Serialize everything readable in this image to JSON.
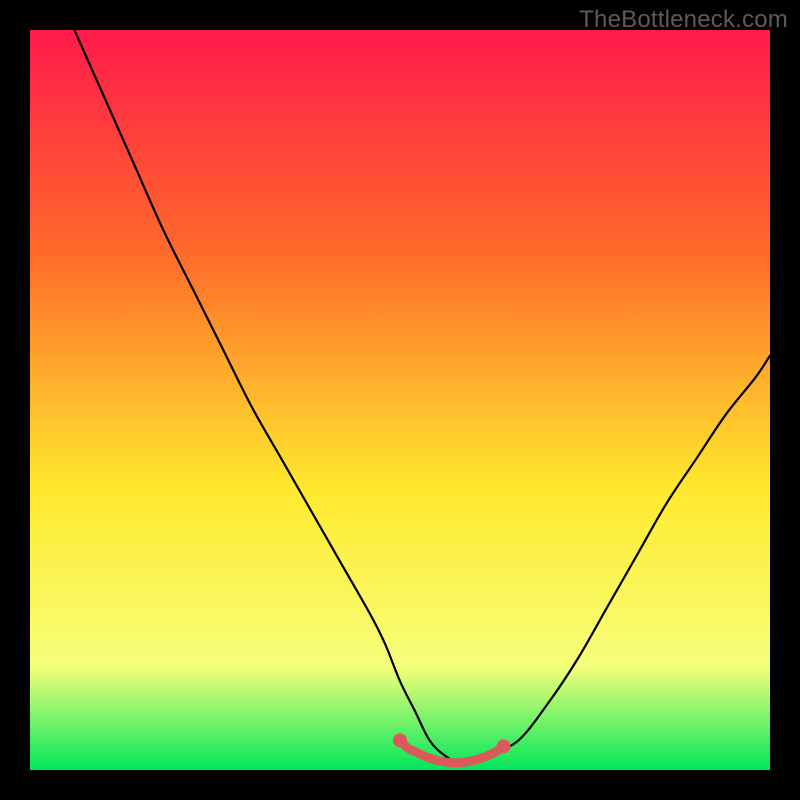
{
  "watermark": "TheBottleneck.com",
  "chart_data": {
    "type": "line",
    "title": "",
    "xlabel": "",
    "ylabel": "",
    "xlim": [
      0,
      100
    ],
    "ylim": [
      0,
      100
    ],
    "series": [
      {
        "name": "bottleneck-curve",
        "x": [
          6,
          10,
          14,
          18,
          22,
          26,
          30,
          34,
          38,
          42,
          46,
          48,
          50,
          52,
          54,
          56,
          58,
          60,
          62,
          66,
          70,
          74,
          78,
          82,
          86,
          90,
          94,
          98,
          100
        ],
        "y": [
          100,
          91,
          82,
          73,
          65,
          57,
          49,
          42,
          35,
          28,
          21,
          17,
          12,
          8,
          4,
          2,
          1,
          1,
          2,
          4,
          9,
          15,
          22,
          29,
          36,
          42,
          48,
          53,
          56
        ]
      },
      {
        "name": "optimal-marker",
        "x": [
          50,
          51,
          52,
          53,
          54,
          55,
          56,
          57,
          58,
          59,
          60,
          61,
          62,
          63,
          64
        ],
        "y": [
          4,
          3,
          2.5,
          2,
          1.6,
          1.3,
          1.1,
          1,
          1,
          1.1,
          1.3,
          1.6,
          2,
          2.5,
          3.2
        ]
      }
    ],
    "gradient_colors": {
      "top": "#ff1a4b",
      "upper": "#ff6a2a",
      "mid": "#ffe92e",
      "lower": "#f6ff7a",
      "bottom": "#00e65b"
    },
    "marker_color": "#d85a5a"
  }
}
